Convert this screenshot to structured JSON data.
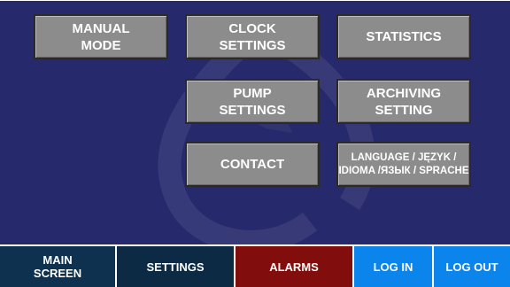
{
  "menu": {
    "manual_mode": "MANUAL\nMODE",
    "clock_settings": "CLOCK\nSETTINGS",
    "statistics": "STATISTICS",
    "pump_settings": "PUMP\nSETTINGS",
    "archiving_setting": "ARCHIVING\nSETTING",
    "contact": "CONTACT",
    "language": "LANGUAGE / JĘZYK /\nIDIOMA /ЯЗЫК / SPRACHE"
  },
  "nav": {
    "main_screen": "MAIN\nSCREEN",
    "settings": "SETTINGS",
    "alarms": "ALARMS",
    "log_in": "LOG IN",
    "log_out": "LOG OUT"
  },
  "colors": {
    "screen_bg": "#26296b",
    "tile_bg": "#8d8c8c",
    "nav_dark": "#0f3150",
    "nav_settings": "#0c2a44",
    "nav_alarms": "#820d0d",
    "nav_blue": "#0b84ec"
  },
  "icons": {
    "watermark": "water-drop-logo-watermark"
  }
}
